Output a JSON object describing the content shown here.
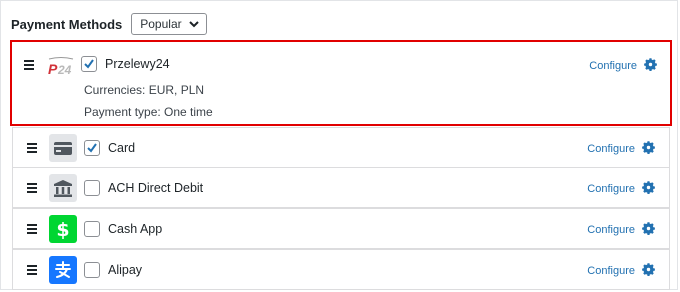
{
  "header": {
    "title": "Payment Methods",
    "sort_label": "Popular"
  },
  "methods": [
    {
      "name": "Przelewy24",
      "checked": true,
      "icon": "p24-logo",
      "currencies": "Currencies: EUR, PLN",
      "payment_type": "Payment type: One time",
      "configure": "Configure"
    },
    {
      "name": "Card",
      "checked": true,
      "icon": "card-icon",
      "configure": "Configure"
    },
    {
      "name": "ACH Direct Debit",
      "checked": false,
      "icon": "bank-icon",
      "configure": "Configure"
    },
    {
      "name": "Cash App",
      "checked": false,
      "icon": "cashapp-icon",
      "configure": "Configure"
    },
    {
      "name": "Alipay",
      "checked": false,
      "icon": "alipay-icon",
      "configure": "Configure"
    }
  ],
  "colors": {
    "link": "#2271b1",
    "highlight": "#e10000",
    "checkmark": "#2271b1",
    "cashapp": "#00d632",
    "alipay": "#1677ff"
  }
}
